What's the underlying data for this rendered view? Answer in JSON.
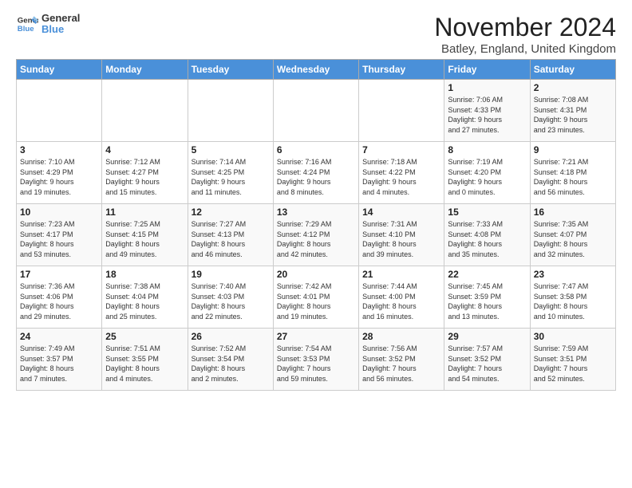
{
  "logo": {
    "line1": "General",
    "line2": "Blue"
  },
  "title": "November 2024",
  "location": "Batley, England, United Kingdom",
  "weekdays": [
    "Sunday",
    "Monday",
    "Tuesday",
    "Wednesday",
    "Thursday",
    "Friday",
    "Saturday"
  ],
  "weeks": [
    [
      {
        "day": "",
        "info": ""
      },
      {
        "day": "",
        "info": ""
      },
      {
        "day": "",
        "info": ""
      },
      {
        "day": "",
        "info": ""
      },
      {
        "day": "",
        "info": ""
      },
      {
        "day": "1",
        "info": "Sunrise: 7:06 AM\nSunset: 4:33 PM\nDaylight: 9 hours\nand 27 minutes."
      },
      {
        "day": "2",
        "info": "Sunrise: 7:08 AM\nSunset: 4:31 PM\nDaylight: 9 hours\nand 23 minutes."
      }
    ],
    [
      {
        "day": "3",
        "info": "Sunrise: 7:10 AM\nSunset: 4:29 PM\nDaylight: 9 hours\nand 19 minutes."
      },
      {
        "day": "4",
        "info": "Sunrise: 7:12 AM\nSunset: 4:27 PM\nDaylight: 9 hours\nand 15 minutes."
      },
      {
        "day": "5",
        "info": "Sunrise: 7:14 AM\nSunset: 4:25 PM\nDaylight: 9 hours\nand 11 minutes."
      },
      {
        "day": "6",
        "info": "Sunrise: 7:16 AM\nSunset: 4:24 PM\nDaylight: 9 hours\nand 8 minutes."
      },
      {
        "day": "7",
        "info": "Sunrise: 7:18 AM\nSunset: 4:22 PM\nDaylight: 9 hours\nand 4 minutes."
      },
      {
        "day": "8",
        "info": "Sunrise: 7:19 AM\nSunset: 4:20 PM\nDaylight: 9 hours\nand 0 minutes."
      },
      {
        "day": "9",
        "info": "Sunrise: 7:21 AM\nSunset: 4:18 PM\nDaylight: 8 hours\nand 56 minutes."
      }
    ],
    [
      {
        "day": "10",
        "info": "Sunrise: 7:23 AM\nSunset: 4:17 PM\nDaylight: 8 hours\nand 53 minutes."
      },
      {
        "day": "11",
        "info": "Sunrise: 7:25 AM\nSunset: 4:15 PM\nDaylight: 8 hours\nand 49 minutes."
      },
      {
        "day": "12",
        "info": "Sunrise: 7:27 AM\nSunset: 4:13 PM\nDaylight: 8 hours\nand 46 minutes."
      },
      {
        "day": "13",
        "info": "Sunrise: 7:29 AM\nSunset: 4:12 PM\nDaylight: 8 hours\nand 42 minutes."
      },
      {
        "day": "14",
        "info": "Sunrise: 7:31 AM\nSunset: 4:10 PM\nDaylight: 8 hours\nand 39 minutes."
      },
      {
        "day": "15",
        "info": "Sunrise: 7:33 AM\nSunset: 4:08 PM\nDaylight: 8 hours\nand 35 minutes."
      },
      {
        "day": "16",
        "info": "Sunrise: 7:35 AM\nSunset: 4:07 PM\nDaylight: 8 hours\nand 32 minutes."
      }
    ],
    [
      {
        "day": "17",
        "info": "Sunrise: 7:36 AM\nSunset: 4:06 PM\nDaylight: 8 hours\nand 29 minutes."
      },
      {
        "day": "18",
        "info": "Sunrise: 7:38 AM\nSunset: 4:04 PM\nDaylight: 8 hours\nand 25 minutes."
      },
      {
        "day": "19",
        "info": "Sunrise: 7:40 AM\nSunset: 4:03 PM\nDaylight: 8 hours\nand 22 minutes."
      },
      {
        "day": "20",
        "info": "Sunrise: 7:42 AM\nSunset: 4:01 PM\nDaylight: 8 hours\nand 19 minutes."
      },
      {
        "day": "21",
        "info": "Sunrise: 7:44 AM\nSunset: 4:00 PM\nDaylight: 8 hours\nand 16 minutes."
      },
      {
        "day": "22",
        "info": "Sunrise: 7:45 AM\nSunset: 3:59 PM\nDaylight: 8 hours\nand 13 minutes."
      },
      {
        "day": "23",
        "info": "Sunrise: 7:47 AM\nSunset: 3:58 PM\nDaylight: 8 hours\nand 10 minutes."
      }
    ],
    [
      {
        "day": "24",
        "info": "Sunrise: 7:49 AM\nSunset: 3:57 PM\nDaylight: 8 hours\nand 7 minutes."
      },
      {
        "day": "25",
        "info": "Sunrise: 7:51 AM\nSunset: 3:55 PM\nDaylight: 8 hours\nand 4 minutes."
      },
      {
        "day": "26",
        "info": "Sunrise: 7:52 AM\nSunset: 3:54 PM\nDaylight: 8 hours\nand 2 minutes."
      },
      {
        "day": "27",
        "info": "Sunrise: 7:54 AM\nSunset: 3:53 PM\nDaylight: 7 hours\nand 59 minutes."
      },
      {
        "day": "28",
        "info": "Sunrise: 7:56 AM\nSunset: 3:52 PM\nDaylight: 7 hours\nand 56 minutes."
      },
      {
        "day": "29",
        "info": "Sunrise: 7:57 AM\nSunset: 3:52 PM\nDaylight: 7 hours\nand 54 minutes."
      },
      {
        "day": "30",
        "info": "Sunrise: 7:59 AM\nSunset: 3:51 PM\nDaylight: 7 hours\nand 52 minutes."
      }
    ]
  ]
}
